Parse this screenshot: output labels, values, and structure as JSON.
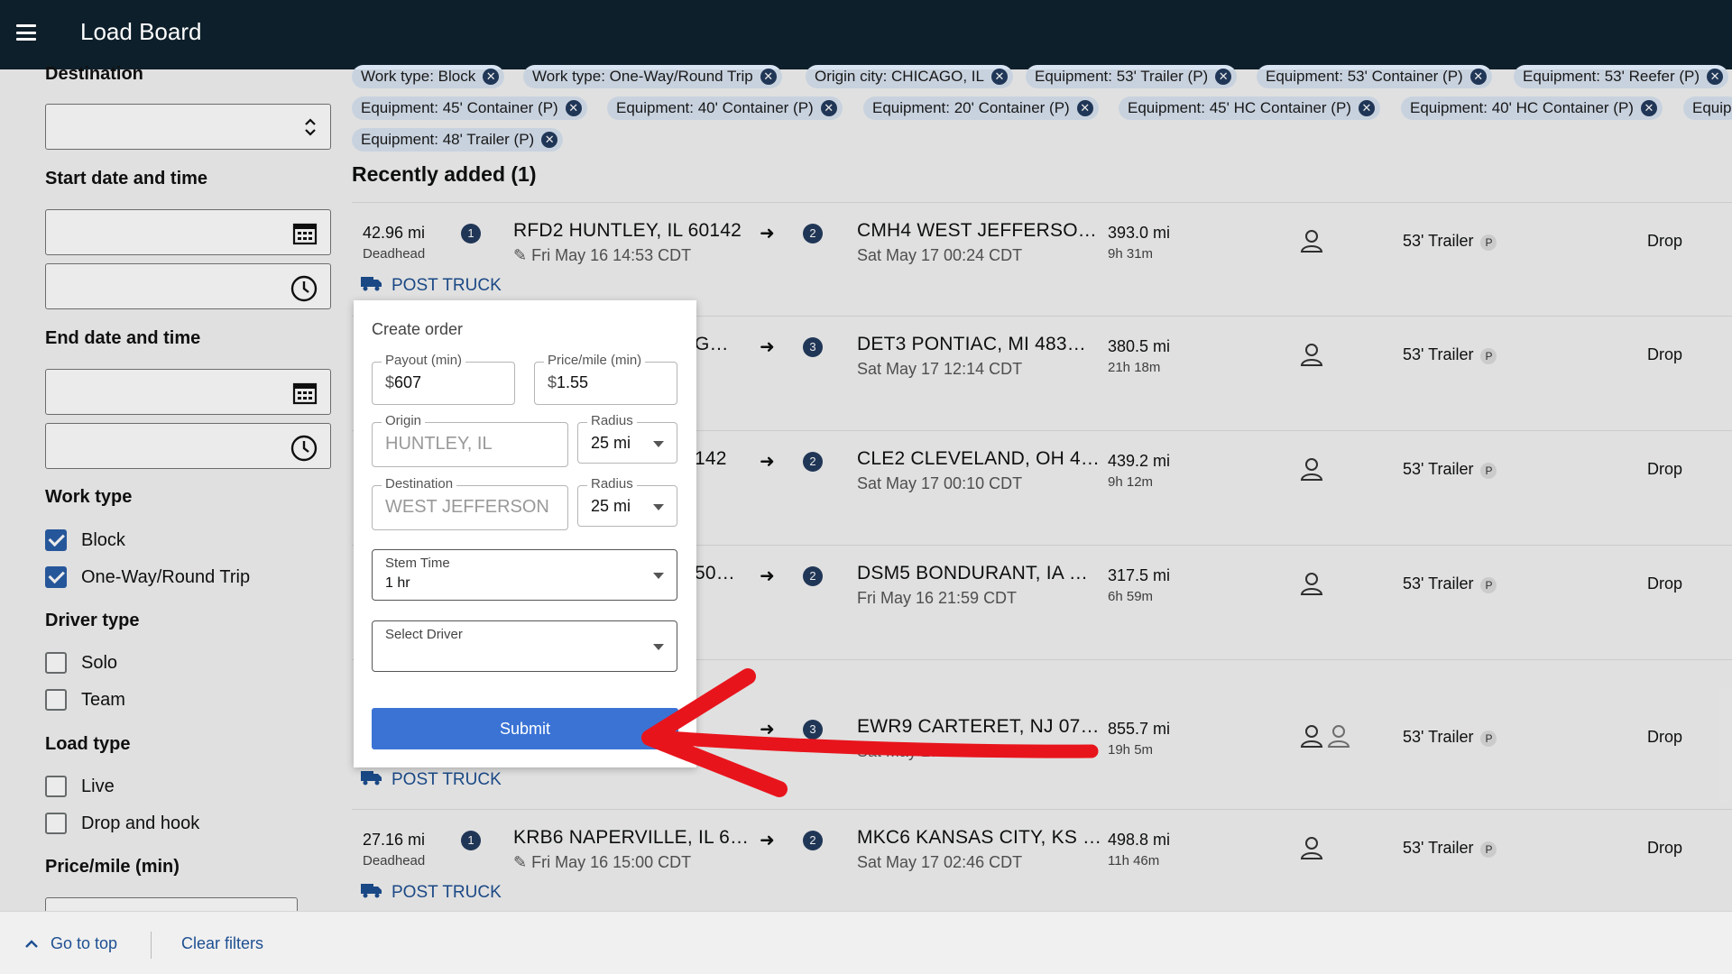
{
  "app": {
    "title": "Load Board"
  },
  "sidebar": {
    "destination_label": "Destination",
    "start_label": "Start date and time",
    "end_label": "End date and time",
    "work_type_label": "Work type",
    "work_types": [
      {
        "label": "Block",
        "checked": true
      },
      {
        "label": "One-Way/Round Trip",
        "checked": true
      }
    ],
    "driver_type_label": "Driver type",
    "driver_types": [
      {
        "label": "Solo",
        "checked": false
      },
      {
        "label": "Team",
        "checked": false
      }
    ],
    "load_type_label": "Load type",
    "load_types": [
      {
        "label": "Live",
        "checked": false
      },
      {
        "label": "Drop and hook",
        "checked": false
      }
    ],
    "price_label": "Price/mile (min)"
  },
  "filters": {
    "chips": [
      "Work type: Block",
      "Work type: One-Way/Round Trip",
      "Origin city: CHICAGO, IL",
      "Equipment: 53' Trailer (P)",
      "Equipment: 53' Container (P)",
      "Equipment: 53' Reefer (P)",
      "Equipment: 45' Container (P)",
      "Equipment: 40' Container (P)",
      "Equipment: 20' Container (P)",
      "Equipment: 45' HC Container (P)",
      "Equipment: 40' HC Container (P)",
      "Equip",
      "Equipment: 48' Trailer (P)"
    ]
  },
  "list": {
    "title": "Recently added (1)",
    "rows": [
      {
        "deadhead": "42.96 mi",
        "deadhead_label": "Deadhead",
        "stop1": "1",
        "origin": "RFD2 HUNTLEY, IL 60142",
        "origin_time": "Fri May 16 14:53 CDT",
        "stop2": "2",
        "dest": "CMH4 WEST JEFFERSO…",
        "dest_time": "Sat May 17 00:24 CDT",
        "distance": "393.0 mi",
        "duration": "9h 31m",
        "equipment": "53' Trailer",
        "equip_badge": "P",
        "load_type": "Drop",
        "post": "POST TRUCK"
      },
      {
        "origin": "G…",
        "stop2": "3",
        "dest": "DET3 PONTIAC, MI 483…",
        "dest_time": "Sat May 17 12:14 CDT",
        "distance": "380.5 mi",
        "duration": "21h 18m",
        "equipment": "53' Trailer",
        "equip_badge": "P",
        "load_type": "Drop"
      },
      {
        "origin": "142",
        "stop2": "2",
        "dest": "CLE2 CLEVELAND, OH 4…",
        "dest_time": "Sat May 17 00:10 CDT",
        "distance": "439.2 mi",
        "duration": "9h 12m",
        "equipment": "53' Trailer",
        "equip_badge": "P",
        "load_type": "Drop"
      },
      {
        "origin": "50…",
        "stop2": "2",
        "dest": "DSM5 BONDURANT, IA …",
        "dest_time": "Fri May 16 21:59 CDT",
        "distance": "317.5 mi",
        "duration": "6h 59m",
        "equipment": "53' Trailer",
        "equip_badge": "P",
        "load_type": "Drop"
      },
      {
        "stop2": "3",
        "dest": "EWR9 CARTERET, NJ 07…",
        "dest_time": "Sat May 17 13:05 CDT",
        "distance": "855.7 mi",
        "duration": "19h 5m",
        "equipment": "53' Trailer",
        "equip_badge": "P",
        "load_type": "Drop",
        "post": "POST TRUCK"
      },
      {
        "deadhead": "27.16 mi",
        "deadhead_label": "Deadhead",
        "stop1": "1",
        "origin": "KRB6 NAPERVILLE, IL 6…",
        "origin_time": "Fri May 16 15:00 CDT",
        "stop2": "2",
        "dest": "MKC6 KANSAS CITY, KS …",
        "dest_time": "Sat May 17 02:46 CDT",
        "distance": "498.8 mi",
        "duration": "11h 46m",
        "equipment": "53' Trailer",
        "equip_badge": "P",
        "load_type": "Drop",
        "post": "POST TRUCK"
      }
    ]
  },
  "modal": {
    "title": "Create order",
    "payout_label": "Payout (min)",
    "payout_prefix": "$",
    "payout_value": "607",
    "price_label": "Price/mile (min)",
    "price_prefix": "$",
    "price_value": "1.55",
    "origin_label": "Origin",
    "origin_value": "HUNTLEY, IL",
    "origin_radius_label": "Radius",
    "origin_radius_value": "25 mi",
    "dest_label": "Destination",
    "dest_value": "WEST JEFFERSON",
    "dest_radius_label": "Radius",
    "dest_radius_value": "25 mi",
    "stem_label": "Stem Time",
    "stem_value": "1 hr",
    "driver_label": "Select Driver",
    "submit_label": "Submit"
  },
  "footer": {
    "go_top": "Go to top",
    "clear": "Clear filters"
  },
  "colors": {
    "topbar": "#0d1f2a",
    "accent": "#3b73d5",
    "chip_bg": "#d9e4f2",
    "annotation_arrow": "#e8141c"
  }
}
